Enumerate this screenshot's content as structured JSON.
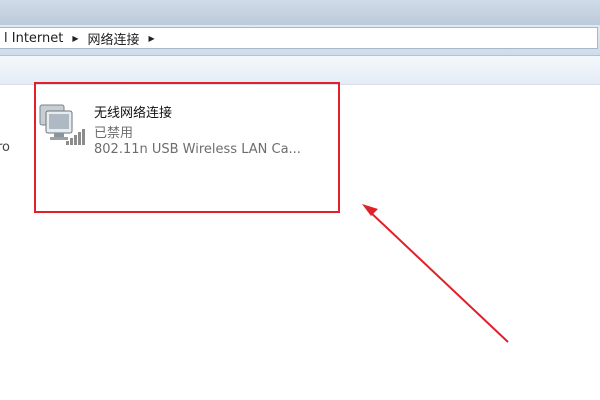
{
  "breadcrumb": {
    "items": [
      "l Internet",
      "网络连接"
    ]
  },
  "left_item": {
    "name_fragment": "ro"
  },
  "adapter": {
    "name": "无线网络连接",
    "status": "已禁用",
    "device": "802.11n USB Wireless LAN Ca...",
    "icon": "wireless-network-adapter-icon"
  },
  "colors": {
    "annotation": "#e0202a",
    "titlebar": "#c4d1df",
    "address_bg": "#dbe6f1"
  }
}
